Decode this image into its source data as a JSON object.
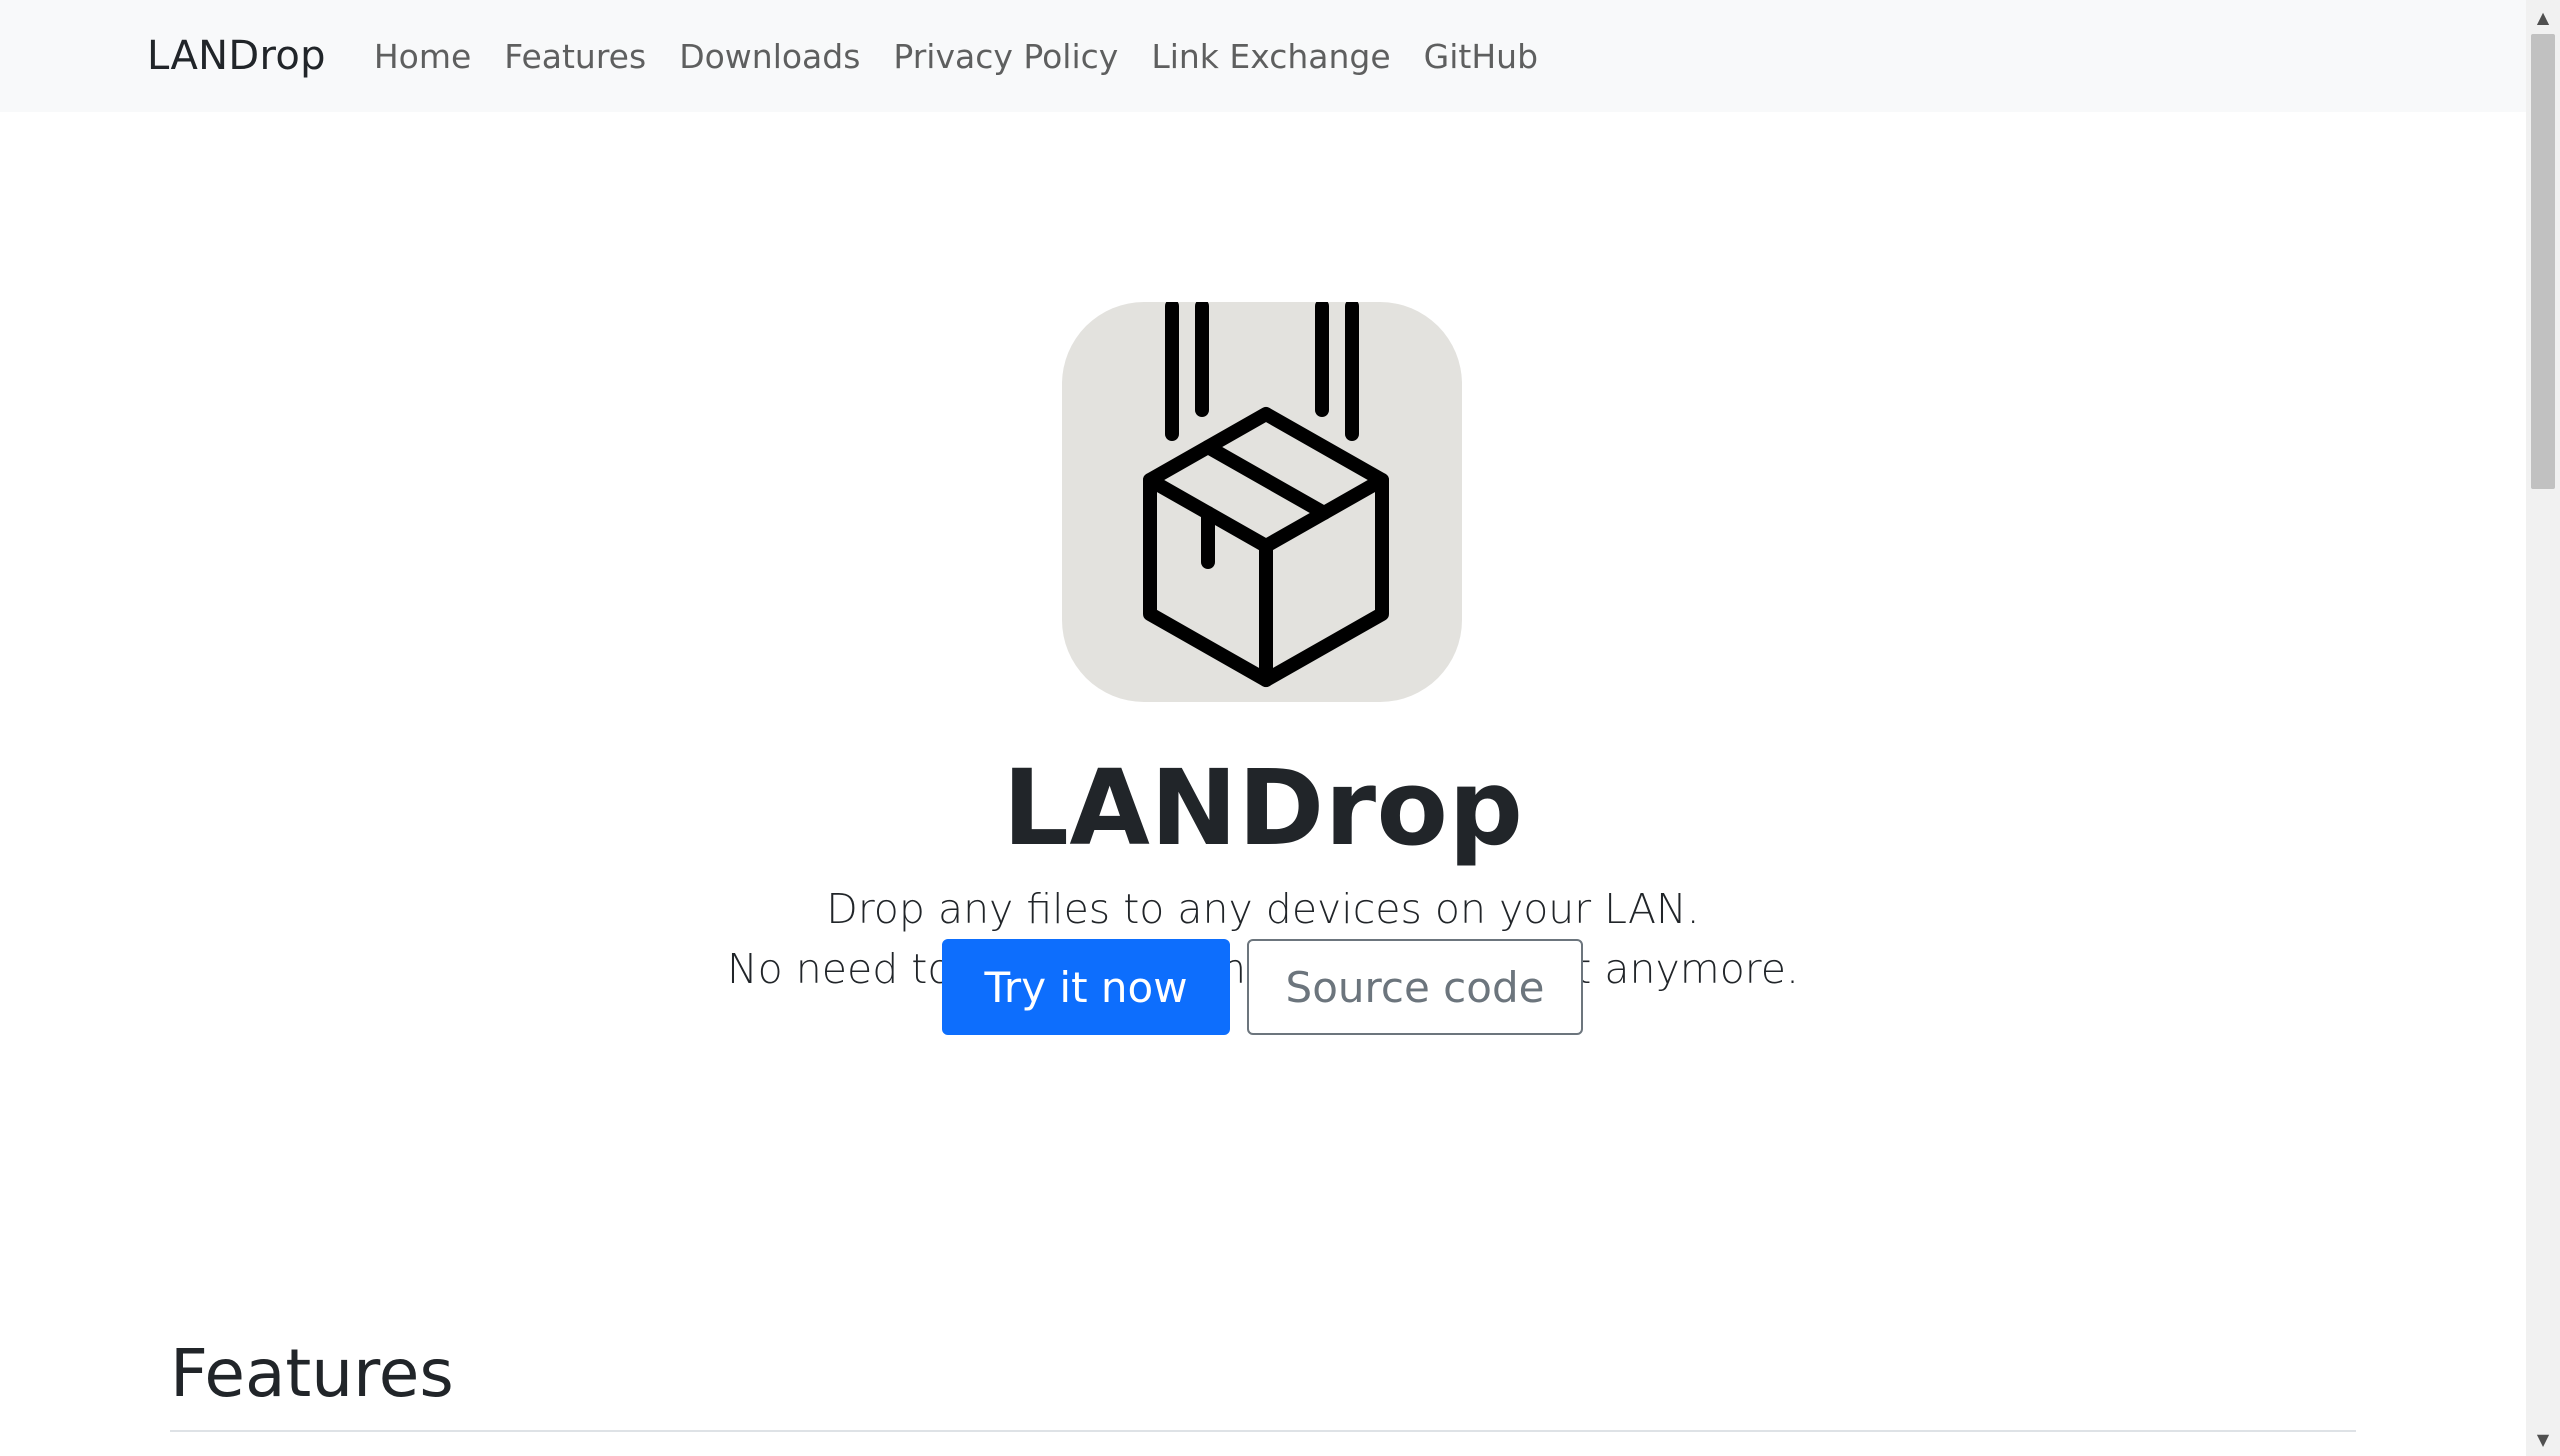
{
  "navbar": {
    "brand": "LANDrop",
    "links": [
      {
        "label": "Home"
      },
      {
        "label": "Features"
      },
      {
        "label": "Downloads"
      },
      {
        "label": "Privacy Policy"
      },
      {
        "label": "Link Exchange"
      },
      {
        "label": "GitHub"
      }
    ]
  },
  "hero": {
    "logo_icon": "falling-package-icon",
    "title": "LANDrop",
    "lead_line1": "Drop any files to any devices on your LAN.",
    "lead_line2": "No need to use instant messaging for that anymore.",
    "primary_button": "Try it now",
    "secondary_button": "Source code"
  },
  "features": {
    "heading": "Features"
  },
  "colors": {
    "navbar_bg": "#f8f9fa",
    "primary": "#0d6efd",
    "secondary": "#6c757d",
    "logo_bg": "#e3e2de",
    "text": "#212529"
  },
  "scrollbar": {
    "up_icon": "scroll-up-arrow-icon",
    "down_icon": "scroll-down-arrow-icon"
  }
}
